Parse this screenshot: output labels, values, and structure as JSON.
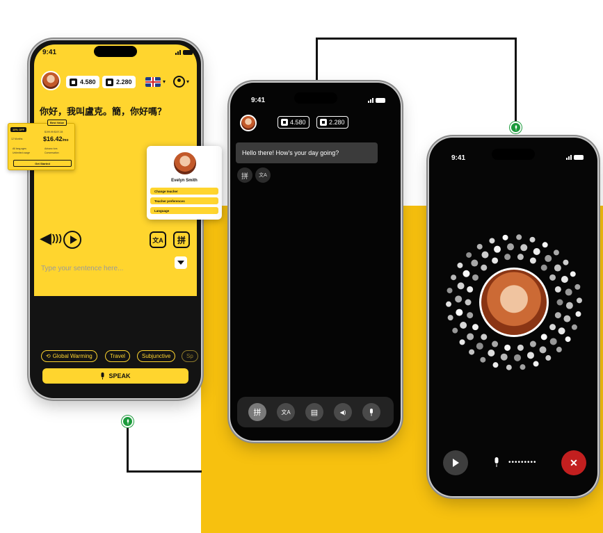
{
  "colors": {
    "accent": "#ffd52e",
    "backdrop": "#f7c10f",
    "mic_green": "#1c9c3c",
    "end_call": "#c21f1f"
  },
  "phone_yellow": {
    "status_time": "9:41",
    "stats": {
      "words": "4.580",
      "cards": "2.280"
    },
    "sentence": "你好，我叫盧克。簡，你好嗎？",
    "input_placeholder": "Type your sentence here...",
    "topics": [
      "Global Warming",
      "Travel",
      "Subjunctive",
      "Sp"
    ],
    "speak_label": "SPEAK",
    "icons": {
      "speaker": "speaker-icon",
      "play": "play-icon",
      "translate": "translate-icon",
      "pinyin": "pinyin-icon"
    },
    "translate_glyph": "文A",
    "pinyin_glyph": "拼"
  },
  "promo_card": {
    "discount": "10% OFF",
    "best_value": "Best Value",
    "plan": "12 Months",
    "old_price": "$199.99 $197.28",
    "price": "$16.42",
    "per": "/mo",
    "features": [
      "All lang.sges",
      "Unlimited usage",
      "Advanc tors",
      "Conversation"
    ],
    "cta": "Get Started"
  },
  "teacher_card": {
    "name": "Evelyn Smith",
    "options": [
      "Change teacher",
      "Teacher preferences",
      "Language"
    ]
  },
  "phone_chat": {
    "status_time": "9:41",
    "stats": {
      "words": "4.580",
      "cards": "2.280"
    },
    "message": "Hello there! How's your day going?",
    "mini_glyphs": [
      "拼",
      "文A"
    ],
    "toolbar_glyphs": [
      "拼",
      "文A",
      "▤",
      "◀)",
      "🎙"
    ]
  },
  "phone_call": {
    "status_time": "9:41",
    "mic_dots": "•••••••••",
    "end_glyph": "✕"
  }
}
